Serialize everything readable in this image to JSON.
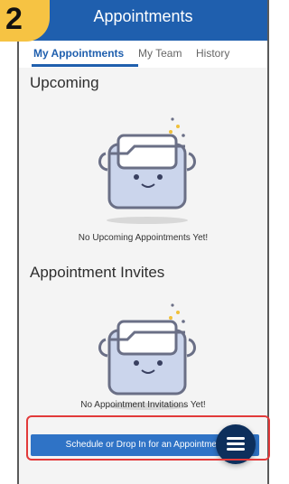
{
  "step_badge": {
    "label": "2"
  },
  "header": {
    "title": "Appointments"
  },
  "tabs": [
    {
      "label": "My Appointments",
      "active": true
    },
    {
      "label": "My Team",
      "active": false
    },
    {
      "label": "History",
      "active": false
    }
  ],
  "upcoming": {
    "title": "Upcoming",
    "empty_text": "No Upcoming Appointments Yet!"
  },
  "invites": {
    "title": "Appointment Invites",
    "empty_text": "No Appointment Invitations Yet!"
  },
  "bottom": {
    "label": "Schedule or Drop In for an Appointment"
  },
  "colors": {
    "accent": "#1f5fae",
    "highlight": "#e23a3a",
    "badge": "#f6c343"
  }
}
